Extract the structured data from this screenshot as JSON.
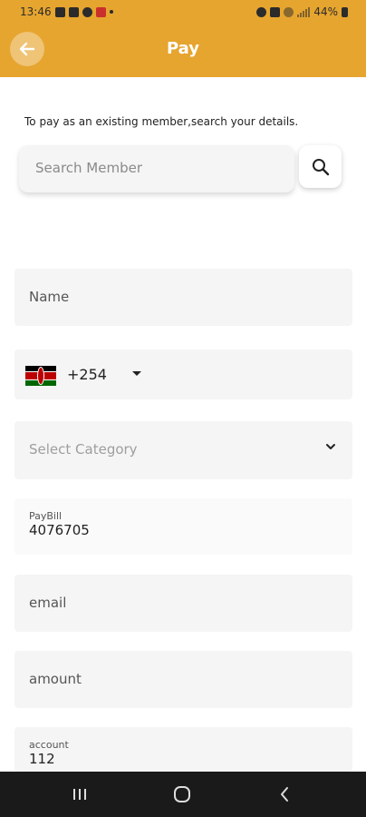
{
  "status_bar": {
    "time": "13:46",
    "battery": "44%"
  },
  "app_bar": {
    "title": "Pay",
    "back_icon": "arrow-left-icon"
  },
  "search": {
    "hint": "To pay as an existing member,search your details.",
    "placeholder": "Search Member",
    "button_icon": "search-icon"
  },
  "form": {
    "name_placeholder": "Name",
    "phone": {
      "country_flag": "kenya-flag-icon",
      "dial_code": "+254"
    },
    "category_placeholder": "Select Category",
    "paybill": {
      "label": "PayBill",
      "value": "4076705"
    },
    "email_placeholder": "email",
    "amount_placeholder": "amount",
    "account": {
      "label": "account",
      "value": "112"
    }
  },
  "colors": {
    "accent": "#e6a52f",
    "field_bg": "#f5f5f5"
  }
}
